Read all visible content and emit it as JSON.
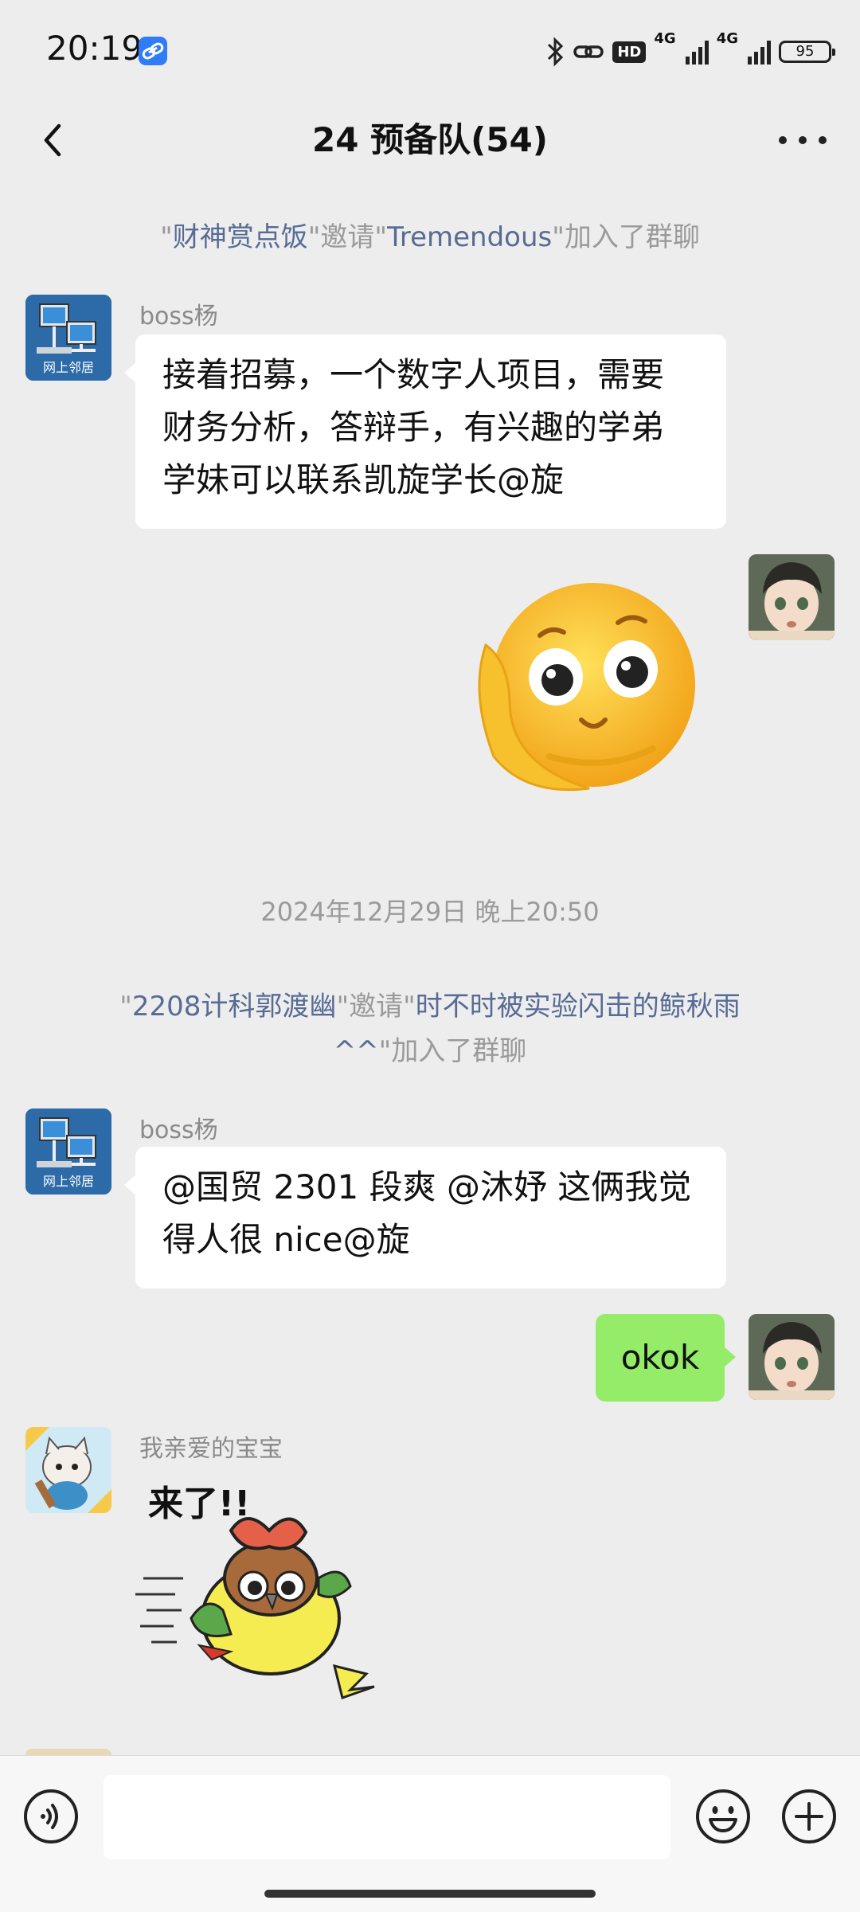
{
  "status_bar": {
    "time": "20:19",
    "network_1": "4G",
    "network_2": "4G",
    "hd_label": "HD",
    "battery": "95"
  },
  "nav": {
    "title": "24 预备队(54)"
  },
  "messages": {
    "sys1": {
      "inviter": "财神赏点饭",
      "verb": "邀请",
      "invitee": "Tremendous",
      "suffix": "加入了群聊"
    },
    "msg1": {
      "sender": "boss杨",
      "text_line1": "接着招募，一个数字人项目，需要",
      "text_line2": "财务分析，答辩手，有兴趣的学弟",
      "text_line3": "学妹可以联系凯旋学长@旋",
      "avatar_label": "网上邻居"
    },
    "timestamp": "2024年12月29日 晚上20:50",
    "sys2": {
      "inviter": "2208计科郭渡幽",
      "verb": "邀请",
      "invitee_line1": "时不时被实验闪击的鲸秋雨",
      "invitee_line2": "^^",
      "suffix": "加入了群聊"
    },
    "msg2": {
      "sender": "boss杨",
      "text_line1": "@国贸 2301 段爽 @沐妤  这俩我觉",
      "text_line2": "得人很 nice@旋",
      "avatar_label": "网上邻居"
    },
    "msg3": {
      "text": "okok"
    },
    "msg4": {
      "sender": "我亲爱的宝宝",
      "sticker_text": "来了!!"
    }
  },
  "colors": {
    "background": "#ededed",
    "bubble_self": "#95ec69",
    "name_link": "#576b95"
  }
}
